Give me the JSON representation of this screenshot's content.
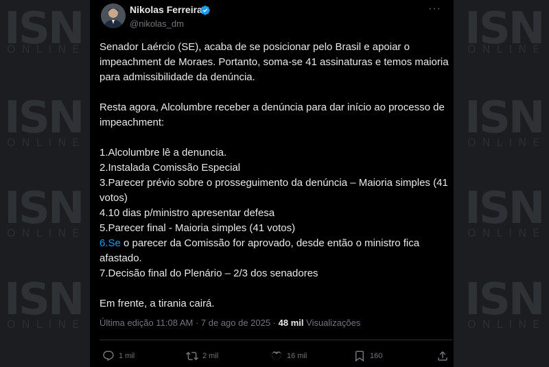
{
  "watermark": {
    "logo": "ISN",
    "tagline": "ONLINE"
  },
  "author": {
    "name": "Nikolas Ferreira",
    "handle": "@nikolas_dm",
    "verified_color": "#1d9bf0",
    "avatar_icon": "avatar"
  },
  "more_label": "···",
  "tweet": {
    "para1": "Senador Laércio (SE), acaba de se posicionar pelo Brasil e apoiar o impeachment de Moraes. Portanto, soma-se 41 assinaturas e temos maioria para admissibilidade da denúncia.",
    "para2": "Resta agora, Alcolumbre receber a denúncia para dar início ao processo de impeachment:",
    "steps": {
      "s1": "1.Alcolumbre lê a denuncia.",
      "s2": "2.Instalada Comissão Especial",
      "s3": "3.Parecer prévio sobre o prosseguimento da denúncia – Maioria simples (41 votos)",
      "s4": "4.10 dias p/ministro apresentar defesa",
      "s5": "5.Parecer final - Maioria simples (41 votos)",
      "s6_link": "6.Se",
      "s6_rest": " o parecer da Comissão for aprovado, desde então o ministro fica afastado.",
      "s7": "7.Decisão final do Plenário – 2/3 dos senadores"
    },
    "closing": "Em frente, a tirania cairá."
  },
  "meta": {
    "edited": "Última edição 11:08 AM · 7 de ago de 2025 · ",
    "views_count": "48 mil",
    "views_label": " Visualizações"
  },
  "actions": {
    "reply_count": "1 mil",
    "retweet_count": "2 mil",
    "like_count": "16 mil",
    "bookmark_count": "160"
  },
  "colors": {
    "background": "#000000",
    "text": "#e7e9ea",
    "secondary": "#71767b",
    "link": "#1d9bf0"
  }
}
